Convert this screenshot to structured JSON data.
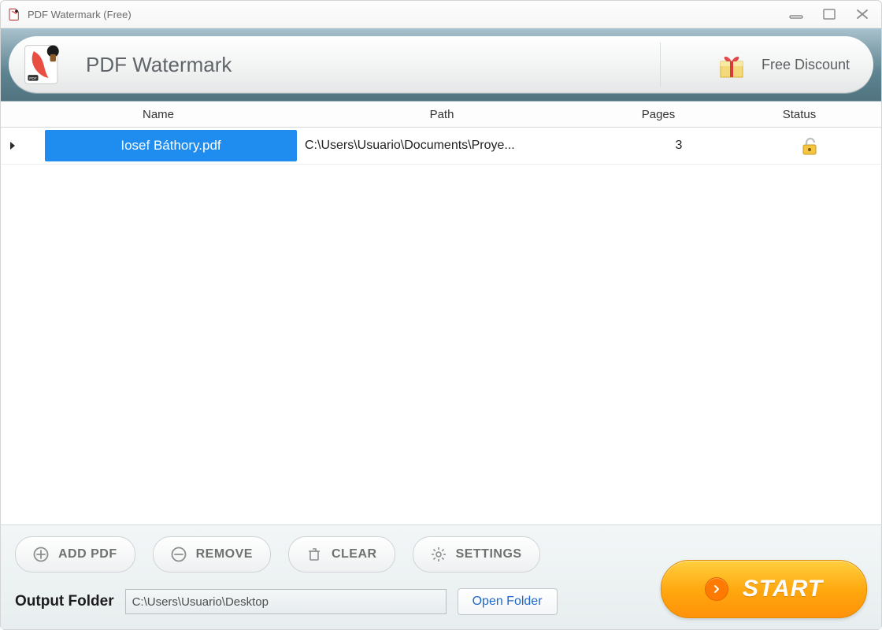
{
  "window": {
    "title": "PDF Watermark (Free)"
  },
  "header": {
    "app_name": "PDF Watermark",
    "discount_label": "Free Discount"
  },
  "table": {
    "columns": {
      "name": "Name",
      "path": "Path",
      "pages": "Pages",
      "status": "Status"
    },
    "row": {
      "name": "Iosef Báthory.pdf",
      "path": "C:\\Users\\Usuario\\Documents\\Proye...",
      "pages": "3"
    }
  },
  "actions": {
    "add": "ADD PDF",
    "remove": "REMOVE",
    "clear": "CLEAR",
    "settings": "SETTINGS",
    "start": "START"
  },
  "output": {
    "label": "Output Folder",
    "path": "C:\\Users\\Usuario\\Desktop",
    "open": "Open Folder"
  }
}
